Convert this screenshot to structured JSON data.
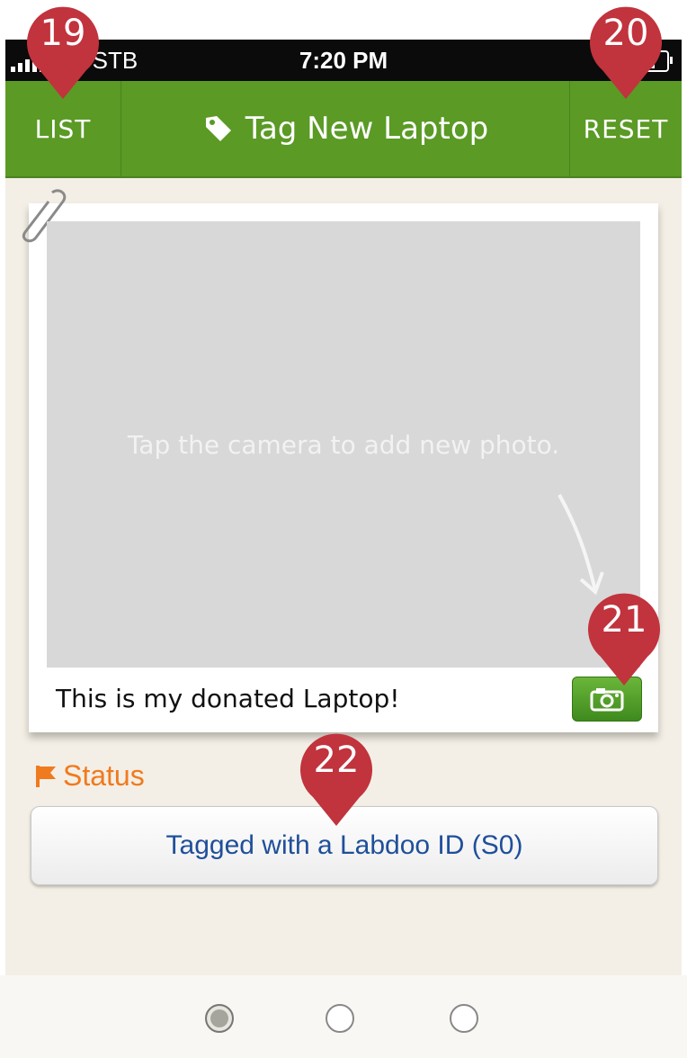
{
  "status_bar": {
    "carrier": "TW-STB",
    "time": "7:20 PM"
  },
  "navbar": {
    "left_button": "LIST",
    "title": "Tag New Laptop",
    "title_icon": "tag-icon",
    "right_button": "RESET"
  },
  "photo_card": {
    "hint": "Tap the camera to add new photo.",
    "caption": "This is my donated Laptop!",
    "camera_icon": "camera-icon"
  },
  "status": {
    "label": "Status",
    "label_icon": "flag-icon",
    "button": "Tagged with a Labdoo ID (S0)"
  },
  "pager": {
    "pages": 3,
    "active_index": 0
  },
  "callouts": [
    "19",
    "20",
    "21",
    "22"
  ],
  "colors": {
    "nav_green": "#5a9a25",
    "status_orange": "#f07a1e",
    "button_blue_text": "#1f4f9a",
    "callout_red": "#c1333d"
  }
}
